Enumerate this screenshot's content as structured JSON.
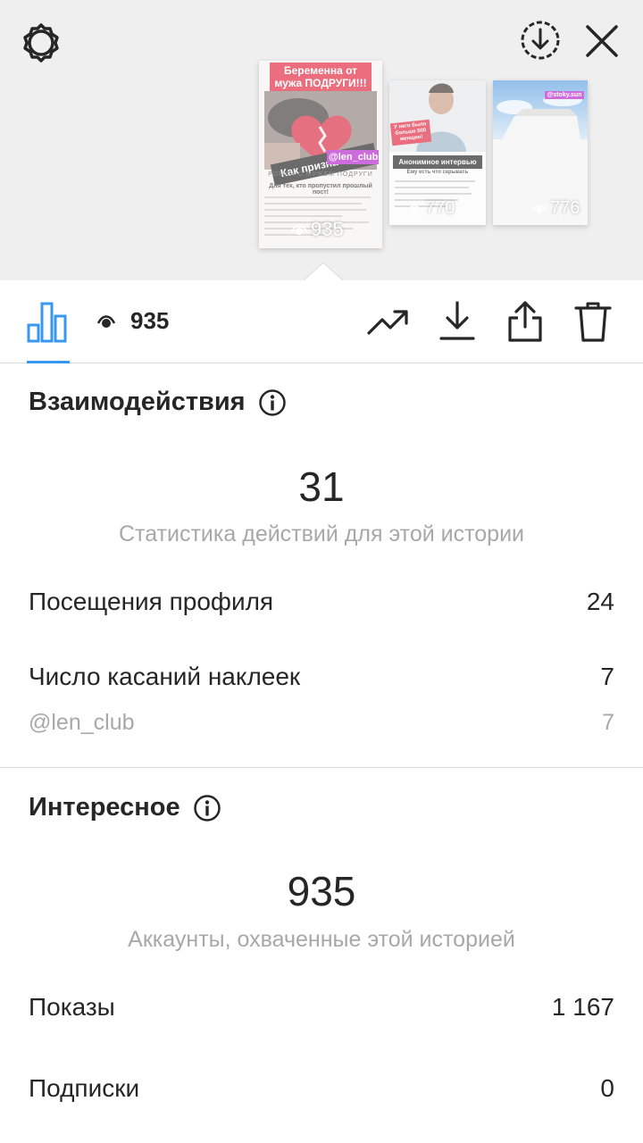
{
  "top_bar": {
    "icons": [
      "settings-icon",
      "download-circle-icon",
      "close-icon"
    ]
  },
  "stories": [
    {
      "headline": "Беременна от мужа ПОДРУГИ!!!",
      "sticker_question": "Как признаться?",
      "mention": "@len_club",
      "subtitle": "РОМАН С МУЖЕМ ПОДРУГИ",
      "caption": "Для тех, кто пропустил прошлый пост!",
      "views": "935"
    },
    {
      "sticker_red": "У него было больше 500 женщин!",
      "banner": "Анонимное интервью",
      "small_text": "Ему есть что скрывать",
      "views": "770"
    },
    {
      "mention": "@stoky.sun",
      "views": "776"
    }
  ],
  "toolbar": {
    "view_count": "935",
    "icons": [
      "insights-icon",
      "eye-icon",
      "trending-icon",
      "download-icon",
      "share-icon",
      "trash-icon"
    ]
  },
  "interactions": {
    "title": "Взаимодействия",
    "total": "31",
    "caption": "Статистика действий для этой истории",
    "rows": [
      {
        "label": "Посещения профиля",
        "value": "24"
      },
      {
        "label": "Число касаний наклеек",
        "value": "7"
      }
    ],
    "sub_rows": [
      {
        "label": "@len_club",
        "value": "7"
      }
    ]
  },
  "discovery": {
    "title": "Интересное",
    "total": "935",
    "caption": "Аккаунты, охваченные этой историей",
    "rows": [
      {
        "label": "Показы",
        "value": "1 167"
      },
      {
        "label": "Подписки",
        "value": "0"
      }
    ]
  },
  "colors": {
    "accent_blue": "#3897f0",
    "sticker_red": "#e0213a",
    "mention_purple": "#b41ecc"
  }
}
